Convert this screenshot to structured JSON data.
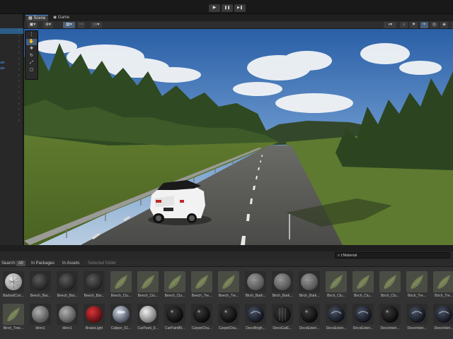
{
  "toolbar": {
    "play_icon": "▶",
    "pause_icon": "❚❚",
    "step_icon": "▶❚"
  },
  "tabs": [
    {
      "label": "Scene",
      "icon": "scene-grid-icon"
    },
    {
      "label": "Game",
      "icon": "game-controller-icon"
    }
  ],
  "hierarchy": {
    "links": [
      "ate",
      "ate"
    ]
  },
  "project": {
    "search_value": "t:Material",
    "filter_label": "Search:",
    "filter_all": "All",
    "filter_packages": "In Packages",
    "filter_assets": "In Assets",
    "filter_selected": "Selected folder"
  },
  "assets_row1": [
    {
      "label": "BarbedCon...",
      "kind": "sphere-white"
    },
    {
      "label": "Beech_Bar...",
      "kind": "sphere-dark"
    },
    {
      "label": "Beech_Bar...",
      "kind": "sphere-dark"
    },
    {
      "label": "Beech_Bar...",
      "kind": "sphere-dark"
    },
    {
      "label": "Beech_Clu...",
      "kind": "leaf"
    },
    {
      "label": "Beech_Clu...",
      "kind": "leaf"
    },
    {
      "label": "Beech_Clu...",
      "kind": "leaf"
    },
    {
      "label": "Beech_Tre...",
      "kind": "leaf"
    },
    {
      "label": "Beech_Tre...",
      "kind": "leaf"
    },
    {
      "label": "Birch_Bark...",
      "kind": "sphere-bark"
    },
    {
      "label": "Birch_Bark...",
      "kind": "sphere-bark"
    },
    {
      "label": "Birch_Bark...",
      "kind": "sphere-bark"
    },
    {
      "label": "Birch_Clu...",
      "kind": "leaf"
    },
    {
      "label": "Birch_Clu...",
      "kind": "leaf"
    },
    {
      "label": "Birch_Clu...",
      "kind": "leaf"
    },
    {
      "label": "Birch_Tre...",
      "kind": "leaf"
    },
    {
      "label": "Birch_Tre...",
      "kind": "leaf"
    }
  ],
  "assets_row2": [
    {
      "label": "Birch_Tree...",
      "kind": "leaf"
    },
    {
      "label": "blinn1",
      "kind": "sphere-grey"
    },
    {
      "label": "blinn1",
      "kind": "sphere-grey"
    },
    {
      "label": "BrakeLight",
      "kind": "sphere-red"
    },
    {
      "label": "Caliper_01...",
      "kind": "sphere-chrome"
    },
    {
      "label": "CarPaint_0...",
      "kind": "sphere-silver"
    },
    {
      "label": "CarPaintBl...",
      "kind": "sphere-black"
    },
    {
      "label": "CarpetCha...",
      "kind": "sphere-black"
    },
    {
      "label": "CarpetCha...",
      "kind": "sphere-black"
    },
    {
      "label": "DecoBrigh...",
      "kind": "sphere-reflect"
    },
    {
      "label": "DecoGutE...",
      "kind": "sphere-stripe"
    },
    {
      "label": "DecoExteri...",
      "kind": "sphere-black"
    },
    {
      "label": "DecoExteri...",
      "kind": "sphere-reflect"
    },
    {
      "label": "DecoExteri...",
      "kind": "sphere-reflect"
    },
    {
      "label": "DecoInteri...",
      "kind": "sphere-black"
    },
    {
      "label": "DecoInteri...",
      "kind": "sphere-reflect"
    },
    {
      "label": "DecoInteri...",
      "kind": "sphere-reflect"
    }
  ]
}
